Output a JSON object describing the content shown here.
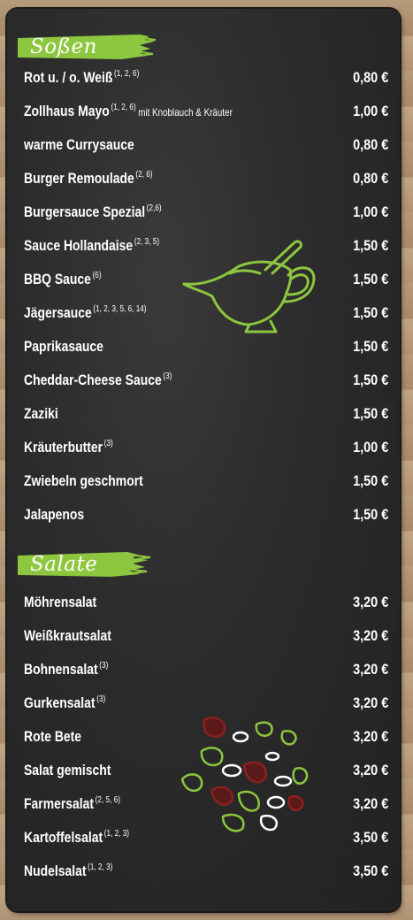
{
  "sections": [
    {
      "title": "Soßen",
      "items": [
        {
          "name": "Rot u. / o. Weiß",
          "notes": "(1, 2, 6)",
          "extra": "",
          "price": "0,80 €"
        },
        {
          "name": "Zollhaus Mayo",
          "notes": "(1, 2, 6)",
          "extra": "mit Knoblauch & Kräuter",
          "price": "1,00 €"
        },
        {
          "name": "warme Currysauce",
          "notes": "",
          "extra": "",
          "price": "0,80 €"
        },
        {
          "name": "Burger Remoulade",
          "notes": "(2, 6)",
          "extra": "",
          "price": "0,80 €"
        },
        {
          "name": "Burgersauce Spezial",
          "notes": "(2,6)",
          "extra": "",
          "price": "1,00 €"
        },
        {
          "name": "Sauce Hollandaise",
          "notes": "(2, 3, 5)",
          "extra": "",
          "price": "1,50 €"
        },
        {
          "name": "BBQ Sauce",
          "notes": "(6)",
          "extra": "",
          "price": "1,50 €"
        },
        {
          "name": "Jägersauce",
          "notes": "(1, 2, 3, 5, 6, 14)",
          "extra": "",
          "price": "1,50 €"
        },
        {
          "name": "Paprikasauce",
          "notes": "",
          "extra": "",
          "price": "1,50 €"
        },
        {
          "name": "Cheddar-Cheese Sauce",
          "notes": "(3)",
          "extra": "",
          "price": "1,50 €"
        },
        {
          "name": "Zaziki",
          "notes": "",
          "extra": "",
          "price": "1,50 €"
        },
        {
          "name": "Kräuterbutter",
          "notes": "(3)",
          "extra": "",
          "price": "1,00 €"
        },
        {
          "name": "Zwiebeln geschmort",
          "notes": "",
          "extra": "",
          "price": "1,50 €"
        },
        {
          "name": "Jalapenos",
          "notes": "",
          "extra": "",
          "price": "1,50 €"
        }
      ]
    },
    {
      "title": "Salate",
      "items": [
        {
          "name": "Möhrensalat",
          "notes": "",
          "extra": "",
          "price": "3,20 €"
        },
        {
          "name": "Weißkrautsalat",
          "notes": "",
          "extra": "",
          "price": "3,20 €"
        },
        {
          "name": "Bohnensalat",
          "notes": "(3)",
          "extra": "",
          "price": "3,20 €"
        },
        {
          "name": "Gurkensalat",
          "notes": "(3)",
          "extra": "",
          "price": "3,20 €"
        },
        {
          "name": "Rote Bete",
          "notes": "",
          "extra": "",
          "price": "3,20 €"
        },
        {
          "name": "Salat gemischt",
          "notes": "",
          "extra": "",
          "price": "3,20 €"
        },
        {
          "name": "Farmersalat",
          "notes": "(2, 5, 6)",
          "extra": "",
          "price": "3,20 €"
        },
        {
          "name": "Kartoffelsalat",
          "notes": "(1, 2, 3)",
          "extra": "",
          "price": "3,50 €"
        },
        {
          "name": "Nudelsalat",
          "notes": "(1, 2, 3)",
          "extra": "",
          "price": "3,50 €"
        }
      ]
    }
  ],
  "colors": {
    "accent": "#8dc63f",
    "chalkboard": "#2b2b2b",
    "text": "#ffffff"
  },
  "icons": [
    "sauce-boat-icon",
    "salad-bowl-icon"
  ]
}
